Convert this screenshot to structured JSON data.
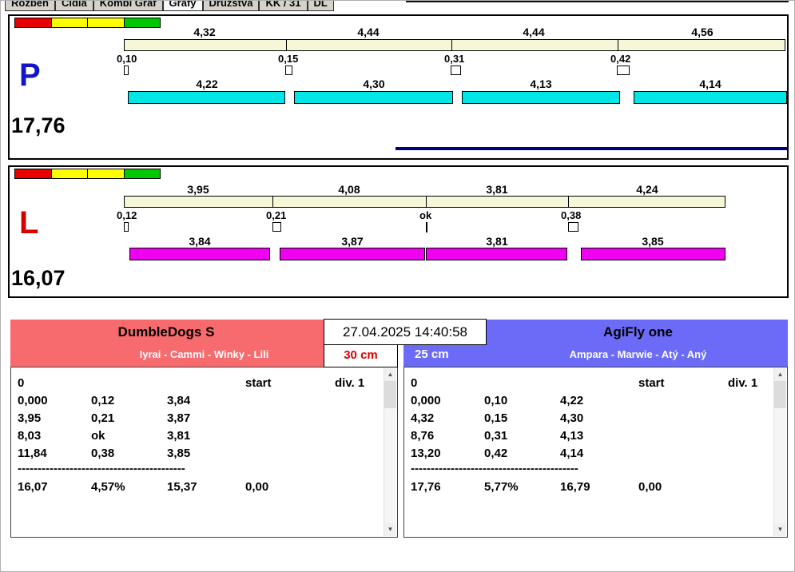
{
  "tabs": [
    "Rozběh",
    "Čidla",
    "Kombi Graf",
    "Grafy",
    "Družstva",
    "KK / 31",
    "DL"
  ],
  "timestamp": "27.04.2025 14:40:58",
  "traffic_colors": [
    "#e80000",
    "#ffff00",
    "#ffff00",
    "#00c800"
  ],
  "icons": {
    "scroll_up": "▲",
    "scroll_down": "▼"
  },
  "lane_p": {
    "label": "P",
    "label_color": "#1414cc",
    "total": "17,76",
    "splits": [
      "4,32",
      "4,44",
      "4,44",
      "4,56"
    ],
    "reactions": [
      "0,10",
      "0,15",
      "0,31",
      "0,42"
    ],
    "dog_times": [
      "4,22",
      "4,30",
      "4,13",
      "4,14"
    ],
    "bar_color": "#00e5e5"
  },
  "lane_l": {
    "label": "L",
    "label_color": "#d40000",
    "total": "16,07",
    "splits": [
      "3,95",
      "4,08",
      "3,81",
      "4,24"
    ],
    "reactions": [
      "0,12",
      "0,21",
      "ok",
      "0,38"
    ],
    "dog_times": [
      "3,84",
      "3,87",
      "3,81",
      "3,85"
    ],
    "bar_color": "#f000f0"
  },
  "team_left": {
    "name": "DumbleDogs S",
    "dogs": "Iyrai - Cammi - Winky - Lili",
    "height": "30 cm",
    "header_color": "#f76b6e",
    "rows": [
      [
        "0",
        "",
        "",
        "start",
        "div. 1"
      ],
      [
        "0,000",
        "0,12",
        "3,84",
        "",
        ""
      ],
      [
        "3,95",
        "0,21",
        "3,87",
        "",
        ""
      ],
      [
        "8,03",
        "ok",
        "3,81",
        "",
        ""
      ],
      [
        "11,84",
        "0,38",
        "3,85",
        "",
        ""
      ]
    ],
    "separator": "------------------------------------------",
    "totals": [
      "16,07",
      "4,57%",
      "15,37",
      "0,00",
      ""
    ]
  },
  "team_right": {
    "name": "AgiFly one",
    "dogs": "Ampara - Marwie - Atý - Aný",
    "height": "25 cm",
    "header_color": "#6b6bf8",
    "rows": [
      [
        "0",
        "",
        "",
        "start",
        "div. 1"
      ],
      [
        "0,000",
        "0,10",
        "4,22",
        "",
        ""
      ],
      [
        "4,32",
        "0,15",
        "4,30",
        "",
        ""
      ],
      [
        "8,76",
        "0,31",
        "4,13",
        "",
        ""
      ],
      [
        "13,20",
        "0,42",
        "4,14",
        "",
        ""
      ]
    ],
    "separator": "------------------------------------------",
    "totals": [
      "17,76",
      "5,77%",
      "16,79",
      "0,00",
      ""
    ]
  }
}
